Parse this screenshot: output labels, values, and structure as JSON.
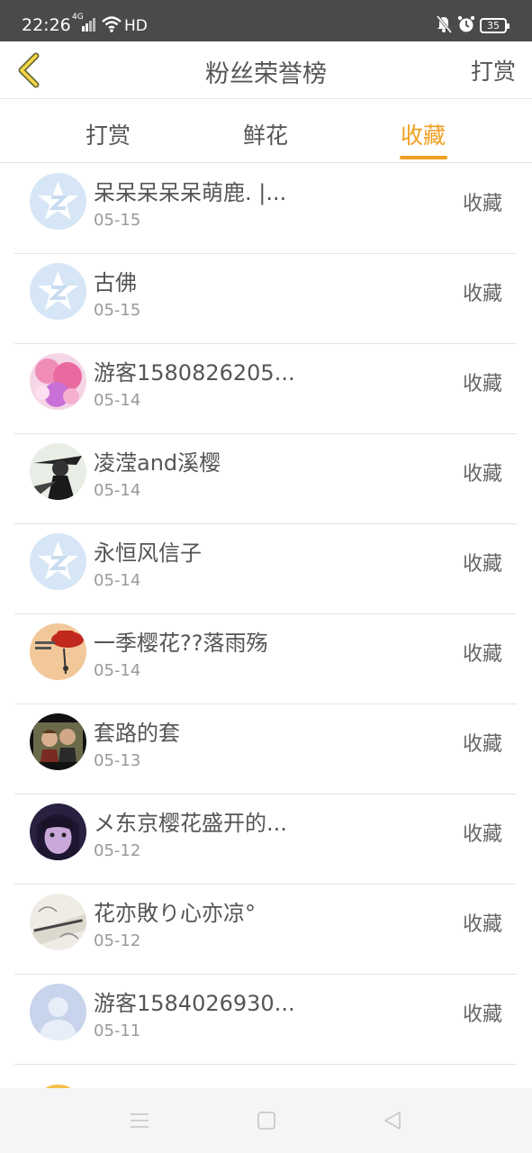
{
  "status_bar": {
    "time": "22:26",
    "network": "4G",
    "hd": "HD",
    "battery": "35"
  },
  "header": {
    "title": "粉丝荣誉榜",
    "right_action": "打赏",
    "back_icon": "chevron-left-icon",
    "accent_color": "#f0a020"
  },
  "tabs": [
    {
      "label": "打赏",
      "active": false
    },
    {
      "label": "鲜花",
      "active": false
    },
    {
      "label": "收藏",
      "active": true
    }
  ],
  "fans": [
    {
      "name": "呆呆呆呆呆萌鹿. |...",
      "date": "05-15",
      "action": "收藏",
      "avatar": "default-star-avatar"
    },
    {
      "name": "古佛",
      "date": "05-15",
      "action": "收藏",
      "avatar": "default-star-avatar"
    },
    {
      "name": "游客1580826205...",
      "date": "05-14",
      "action": "收藏",
      "avatar": "anime-girl-avatar"
    },
    {
      "name": "凌滢and溪樱",
      "date": "05-14",
      "action": "收藏",
      "avatar": "monochrome-figure-avatar"
    },
    {
      "name": "永恒风信子",
      "date": "05-14",
      "action": "收藏",
      "avatar": "default-star-avatar"
    },
    {
      "name": "一季樱花??落雨殇",
      "date": "05-14",
      "action": "收藏",
      "avatar": "hat-sketch-avatar"
    },
    {
      "name": "套路的套",
      "date": "05-13",
      "action": "收藏",
      "avatar": "couple-photo-avatar"
    },
    {
      "name": "メ东京樱花盛开的...",
      "date": "05-12",
      "action": "收藏",
      "avatar": "girl-photo-avatar"
    },
    {
      "name": "花亦敗り心亦凉°",
      "date": "05-12",
      "action": "收藏",
      "avatar": "sketch-text-avatar"
    },
    {
      "name": "游客1584026930...",
      "date": "05-11",
      "action": "收藏",
      "avatar": "default-person-avatar"
    }
  ],
  "system_nav": {
    "menu_icon": "menu-icon",
    "home_icon": "home-icon",
    "back_icon": "back-triangle-icon"
  }
}
